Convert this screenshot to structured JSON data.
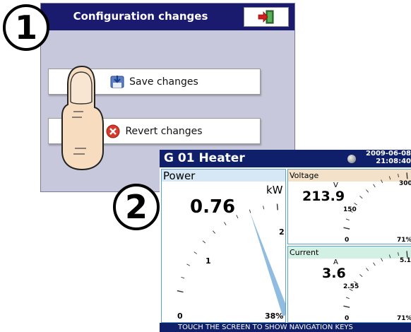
{
  "steps": [
    "1",
    "2"
  ],
  "dialog": {
    "title": "Configuration changes",
    "exit_icon": "exit-door-icon",
    "save_label": "Save changes",
    "save_icon": "save-disk-icon",
    "revert_label": "Revert changes",
    "revert_icon": "red-x-icon"
  },
  "device": {
    "title": "G 01   Heater",
    "date": "2009-06-08",
    "time": "21:08:40",
    "footer": "TOUCH THE SCREEN TO SHOW NAVIGATION KEYS",
    "power": {
      "label": "Power",
      "unit": "kW",
      "value": "0.76",
      "scale_min": "0",
      "scale_mid": "1",
      "scale_max": "2",
      "percent": "38%",
      "fraction": 0.38,
      "color": "#8fbce0"
    },
    "voltage": {
      "label": "Voltage",
      "unit": "V",
      "value": "213.9",
      "scale_min": "0",
      "scale_mid": "150",
      "scale_max": "300",
      "percent": "71%",
      "fraction": 0.71,
      "color": "#e0c49a"
    },
    "current": {
      "label": "Current",
      "unit": "A",
      "value": "3.6",
      "scale_min": "0",
      "scale_mid": "2.55",
      "scale_max": "5.1",
      "percent": "71%",
      "fraction": 0.71,
      "color": "#a8e0c8"
    }
  }
}
